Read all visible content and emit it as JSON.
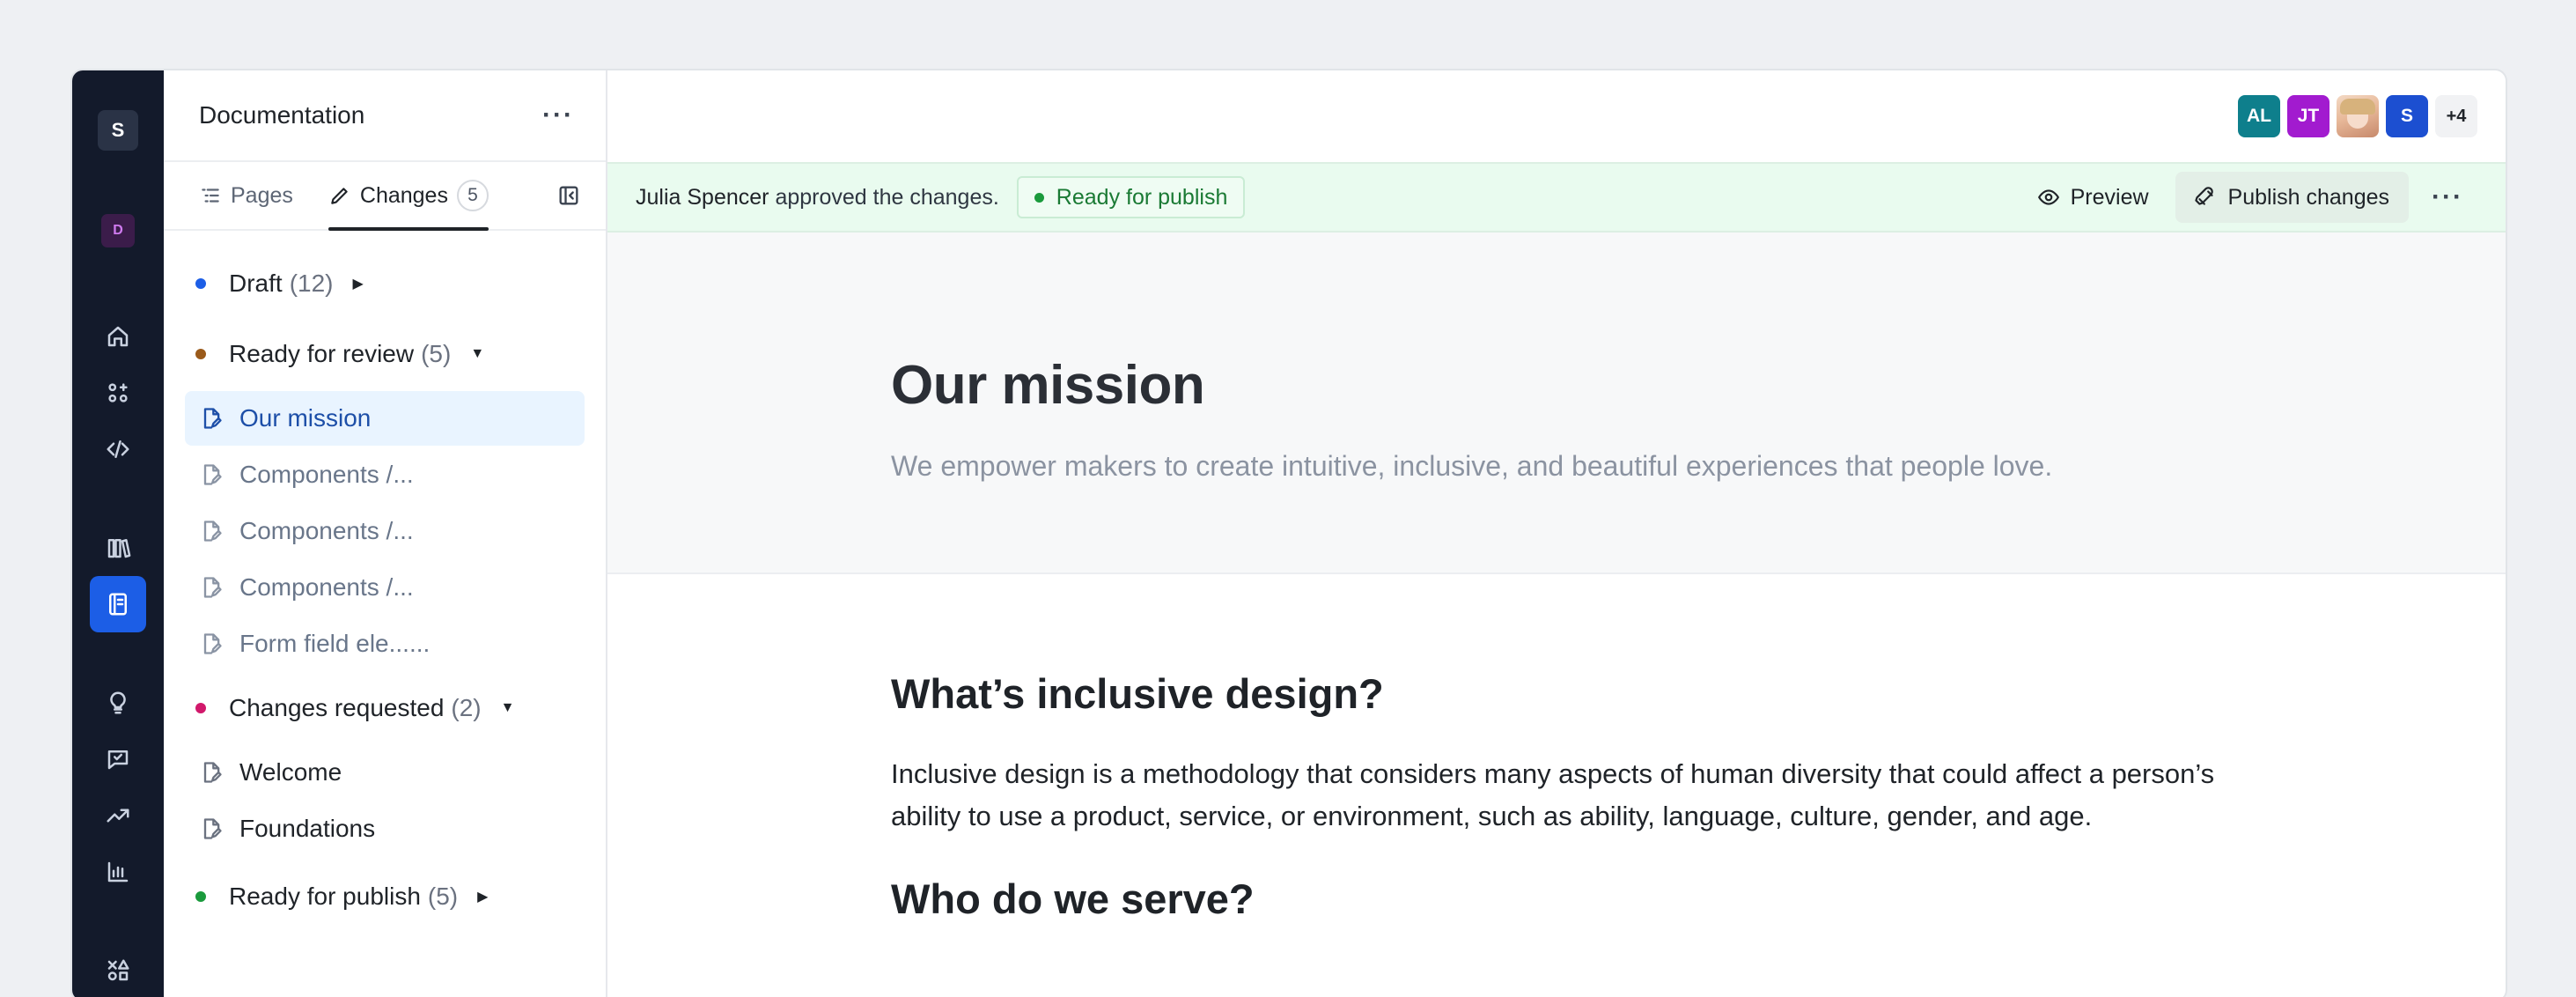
{
  "rail": {
    "workspace_letter": "S",
    "workspace2_letter": "D",
    "icons": [
      "home-icon",
      "components-icon",
      "code-icon",
      "library-icon",
      "docs-icon",
      "bulb-icon",
      "feedback-icon",
      "trend-icon",
      "chart-icon",
      "shapes-icon"
    ]
  },
  "sidebar": {
    "title": "Documentation",
    "tabs": {
      "pages_label": "Pages",
      "changes_label": "Changes",
      "changes_count": "5"
    },
    "groups": {
      "draft": {
        "label": "Draft",
        "count": "(12)",
        "color": "#1c5ee6"
      },
      "review": {
        "label": "Ready for review",
        "count": "(5)",
        "color": "#9a5a1a"
      },
      "requested": {
        "label": "Changes requested",
        "count": "(2)",
        "color": "#d1186b"
      },
      "publish": {
        "label": "Ready for publish",
        "count": "(5)",
        "color": "#1a9a3c"
      }
    },
    "review_items": [
      "Our mission",
      "Components /...",
      "Components /...",
      "Components /...",
      "Form field ele......"
    ],
    "requested_items": [
      "Welcome",
      "Foundations"
    ]
  },
  "topbar": {
    "avatars": [
      {
        "initials": "AL",
        "color": "#0e7f8c"
      },
      {
        "initials": "JT",
        "color": "#a21bcf"
      },
      {
        "initials": "",
        "color": "#e8b99a"
      },
      {
        "initials": "S",
        "color": "#1c4fd1"
      }
    ],
    "more_count": "+4"
  },
  "banner": {
    "user": "Julia Spencer",
    "message": "approved the changes.",
    "status": "Ready for publish",
    "preview_label": "Preview",
    "publish_label": "Publish changes"
  },
  "page": {
    "title": "Our mission",
    "subtitle": "We empower makers to create intuitive, inclusive, and beautiful experiences that people love.",
    "h2_1": "What’s inclusive design?",
    "para_1": "Inclusive design is a methodology that considers many aspects of human diversity that could affect a person’s ability to use a product, service, or environment, such as ability, language, culture, gender, and age.",
    "h2_2": "Who do we serve?"
  }
}
